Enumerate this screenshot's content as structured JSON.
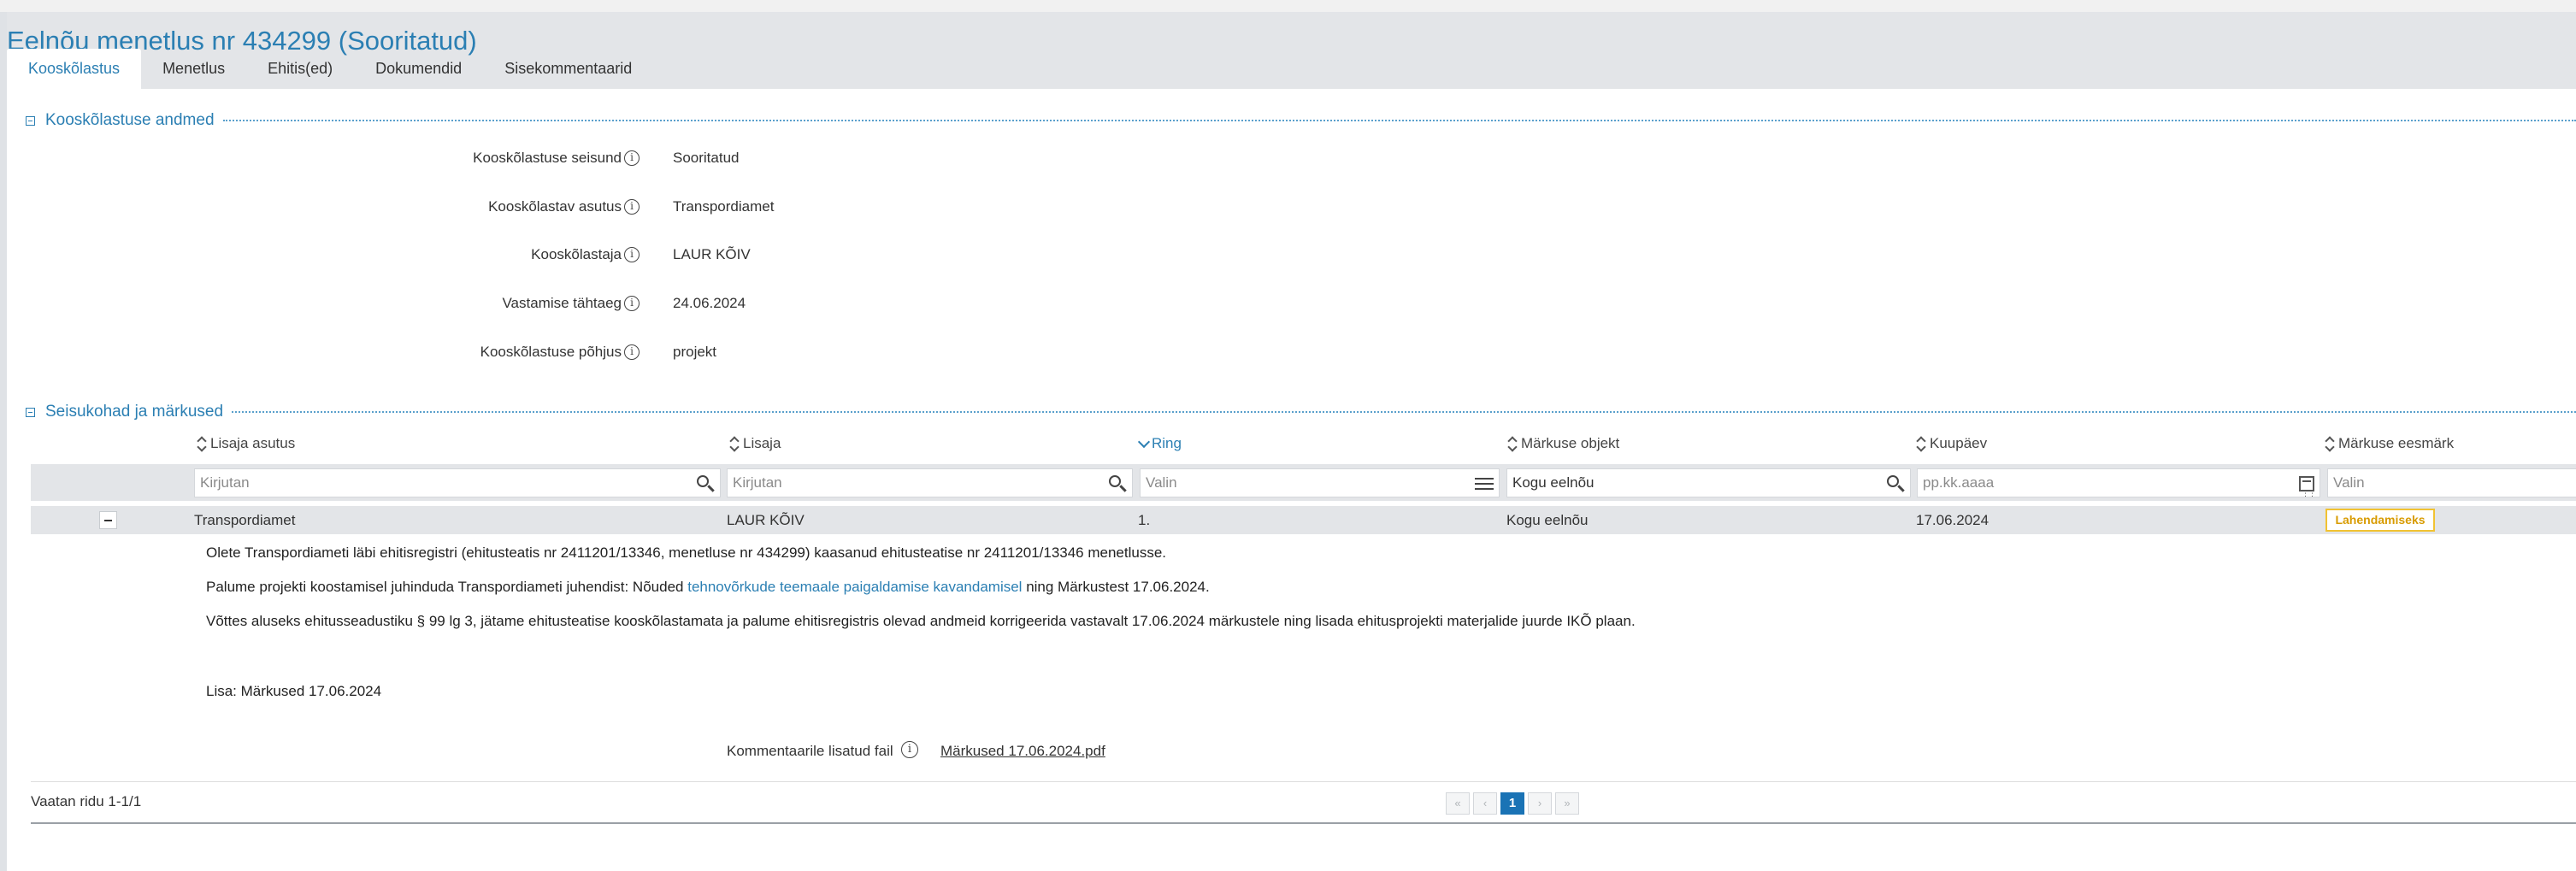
{
  "page": {
    "title": "Eelnõu menetlus nr 434299 (Sooritatud)"
  },
  "tabs": [
    {
      "label": "Kooskõlastus",
      "active": true
    },
    {
      "label": "Menetlus"
    },
    {
      "label": "Ehitis(ed)"
    },
    {
      "label": "Dokumendid"
    },
    {
      "label": "Sisekommentaarid"
    }
  ],
  "details_section": {
    "title": "Kooskõlastuse andmed",
    "fields": [
      {
        "label": "Kooskõlastuse seisund",
        "value": "Sooritatud"
      },
      {
        "label": "Kooskõlastav asutus",
        "value": "Transpordiamet"
      },
      {
        "label": "Kooskõlastaja",
        "value": "LAUR KÕIV"
      },
      {
        "label": "Vastamise tähtaeg",
        "value": "24.06.2024"
      },
      {
        "label": "Kooskõlastuse põhjus",
        "value": "projekt"
      }
    ],
    "info_icon": "info-circle-icon"
  },
  "comments_section": {
    "title": "Seisukohad ja märkused",
    "columns": [
      {
        "label": "Lisaja asutus",
        "sort": "none"
      },
      {
        "label": "Lisaja",
        "sort": "none"
      },
      {
        "label": "Ring",
        "sort": "desc"
      },
      {
        "label": "Märkuse objekt",
        "sort": "none"
      },
      {
        "label": "Kuupäev",
        "sort": "none"
      },
      {
        "label": "Märkuse eesmärk",
        "sort": "none"
      }
    ],
    "filters": [
      {
        "placeholder": "Kirjutan",
        "value": "",
        "icon": "search-icon"
      },
      {
        "placeholder": "Kirjutan",
        "value": "",
        "icon": "search-icon"
      },
      {
        "placeholder": "Valin",
        "value": "",
        "icon": "list-icon"
      },
      {
        "placeholder": "",
        "value": "Kogu eelnõu",
        "icon": "search-icon"
      },
      {
        "placeholder": "pp.kk.aaaa",
        "value": "",
        "icon": "calendar-icon"
      },
      {
        "placeholder": "Valin",
        "value": ""
      }
    ],
    "rows": [
      {
        "agency": "Transpordiamet",
        "author": "LAUR KÕIV",
        "round": "1.",
        "object": "Kogu eelnõu",
        "date": "17.06.2024",
        "purpose": "Lahendamiseks",
        "detail": {
          "para1": "Olete Transpordiameti läbi ehitisregistri (ehitusteatis nr 2411201/13346, menetluse nr 434299) kaasanud ehitusteatise nr 2411201/13346 menetlusse.",
          "para2_before": "Palume projekti koostamisel juhinduda Transpordiameti juhendist: Nõuded ",
          "para2_link": "tehnovõrkude teemaale paigaldamise kavandamisel",
          "para2_after": " ning Märkustest 17.06.2024.",
          "para3": "Võttes aluseks ehitusseadustiku § 99 lg 3, jätame ehitusteatise kooskõlastamata ja palume ehitisregistris olevad andmeid korrigeerida vastavalt 17.06.2024 märkustele ning lisada ehitusprojekti materjalide juurde IKÕ plaan.",
          "para4": "Lisa: Märkused 17.06.2024",
          "file_label": "Kommentaarile lisatud fail",
          "file_name": "Märkused 17.06.2024.pdf"
        }
      }
    ],
    "rows_info": "Vaatan ridu 1-1/1",
    "pager": {
      "first": "«",
      "prev": "‹",
      "current": "1",
      "next": "›",
      "last": "»"
    },
    "badge_color": "#f1c232"
  },
  "colors": {
    "accent": "#2b7fb3",
    "header_bg": "#e3e5e8"
  }
}
